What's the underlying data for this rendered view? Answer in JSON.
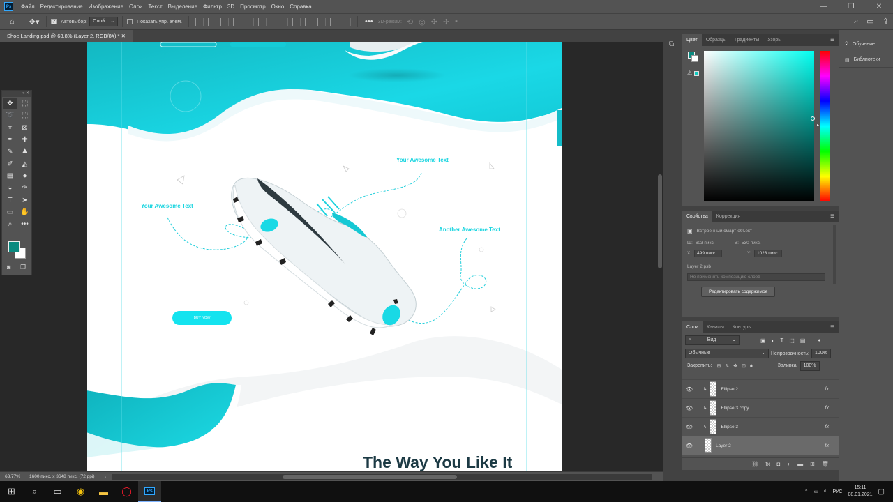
{
  "app": {
    "menu": [
      "Файл",
      "Редактирование",
      "Изображение",
      "Слои",
      "Текст",
      "Выделение",
      "Фильтр",
      "3D",
      "Просмотр",
      "Окно",
      "Справка"
    ]
  },
  "options": {
    "autoselect_label": "Автовыбор:",
    "autoselect_value": "Слой",
    "show_controls_label": "Показать упр. элем.",
    "mode_3d_label": "3D-режим:"
  },
  "document": {
    "tab_title": "Shoe Landing.psd @ 63,8% (Layer 2, RGB/8#) *",
    "zoom": "63,77%",
    "doc_info": "1600 пикс. x 3648 пикс. (72 ppi)"
  },
  "design": {
    "left_text": "Your Awesome Text",
    "top_text": "Your Awesome Text",
    "right_text": "Another Awesome Text",
    "buy_button": "BUY NOW",
    "headline": "The Way You Like It"
  },
  "colors": {
    "foreground": "#0b8a80",
    "background": "#ffffff",
    "accent": "#14e3ef",
    "headline": "#1c3a44"
  },
  "color_panel": {
    "tabs": [
      "Цвет",
      "Образцы",
      "Градиенты",
      "Узоры"
    ]
  },
  "properties": {
    "tabs": [
      "Свойства",
      "Коррекция"
    ],
    "object_type": "Встроенный смарт-объект",
    "w_label": "Ш:",
    "w_value": "603 пикс.",
    "h_label": "В:",
    "h_value": "530 пикс.",
    "x_label": "X:",
    "x_value": "499 пикс.",
    "y_label": "Y:",
    "y_value": "1023 пикс.",
    "file": "Layer 2.psb",
    "comp_placeholder": "Не применять композицию слоев",
    "edit_button": "Редактировать содержимое"
  },
  "layers": {
    "tabs": [
      "Слои",
      "Каналы",
      "Контуры"
    ],
    "filter_value": "Вид",
    "blend_mode": "Обычные",
    "opacity_label": "Непрозрачность:",
    "opacity_value": "100%",
    "lock_label": "Закрепить:",
    "fill_label": "Заливка:",
    "fill_value": "100%",
    "items": [
      {
        "name": "Ellipse 2",
        "fx": "fx"
      },
      {
        "name": "Ellipse 3 copy",
        "fx": "fx"
      },
      {
        "name": "Ellipse 3",
        "fx": "fx"
      },
      {
        "name": "Layer 2",
        "fx": "fx"
      }
    ]
  },
  "learn": {
    "items": [
      "Обучение",
      "Библиотеки"
    ]
  },
  "taskbar": {
    "lang": "РУС",
    "time": "15:11",
    "date": "08.01.2021"
  }
}
